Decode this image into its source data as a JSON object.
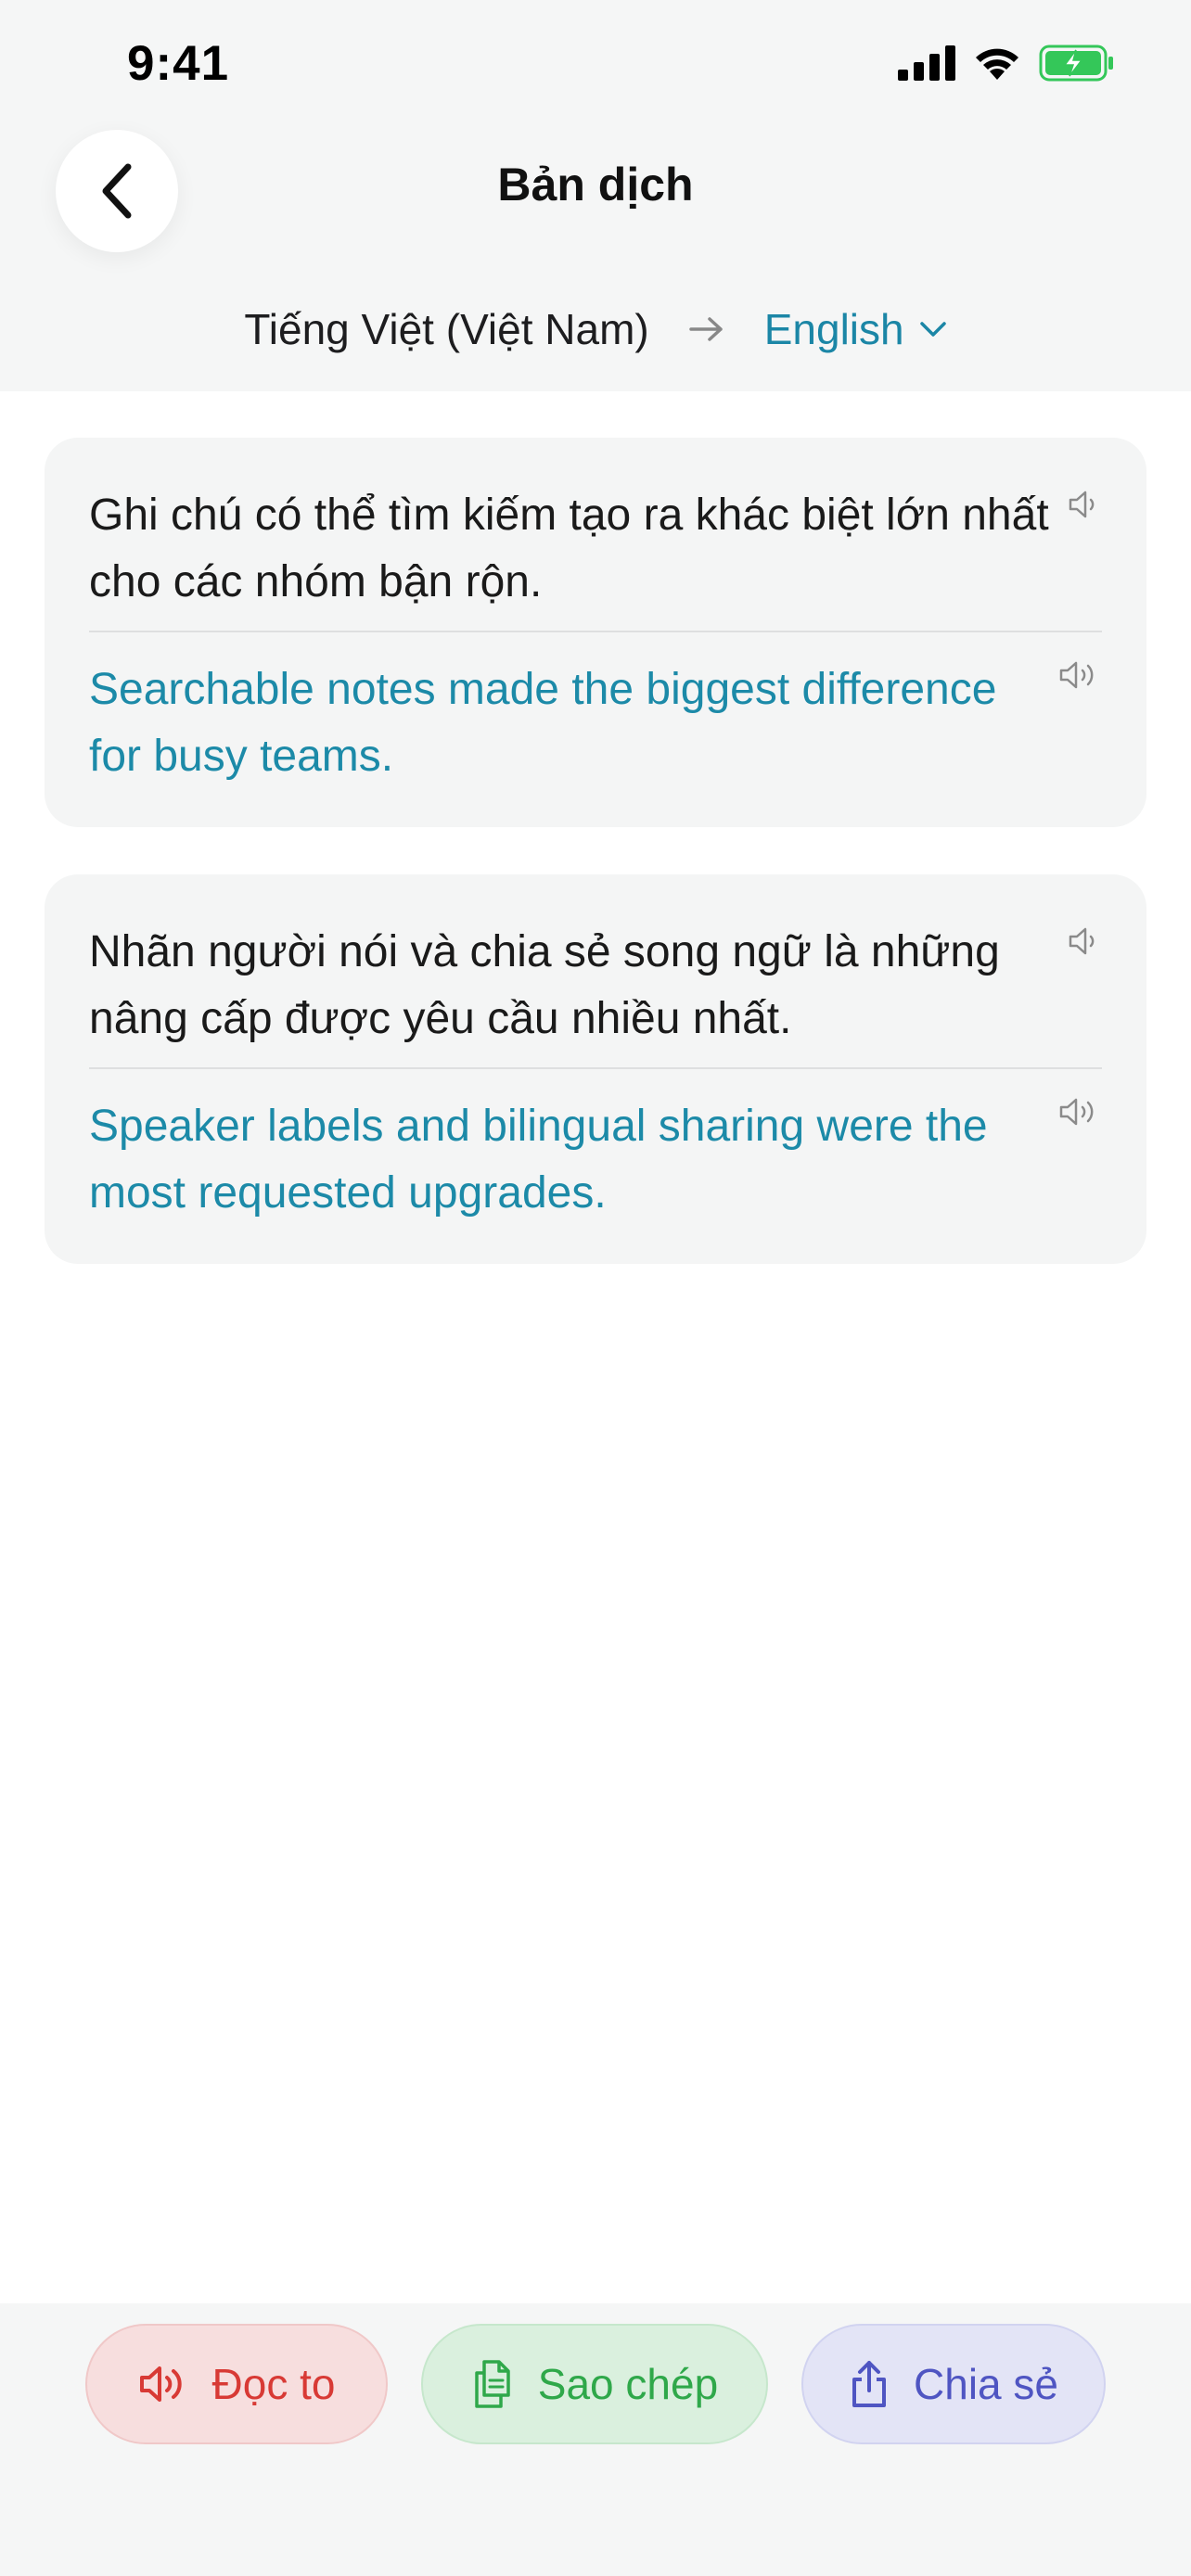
{
  "status_bar": {
    "time": "9:41"
  },
  "header": {
    "title": "Bản dịch",
    "back_icon": "chevron-left-icon"
  },
  "languages": {
    "source": "Tiếng Việt (Việt Nam)",
    "target": "English"
  },
  "cards": [
    {
      "source": "Ghi chú có thể tìm kiếm tạo ra khác biệt lớn nhất cho các nhóm bận rộn.",
      "translation": "Searchable notes made the biggest difference for busy teams."
    },
    {
      "source": "Nhãn người nói và chia sẻ song ngữ là những nâng cấp được yêu cầu nhiều nhất.",
      "translation": "Speaker labels and bilingual sharing were the most requested upgrades."
    }
  ],
  "actions": {
    "read_label": "Đọc to",
    "copy_label": "Sao chép",
    "share_label": "Chia sẻ"
  },
  "colors": {
    "accent": "#1b86a6",
    "read": "#d83a35",
    "copy": "#2fa84a",
    "share": "#4f55c2",
    "battery": "#34c759"
  }
}
